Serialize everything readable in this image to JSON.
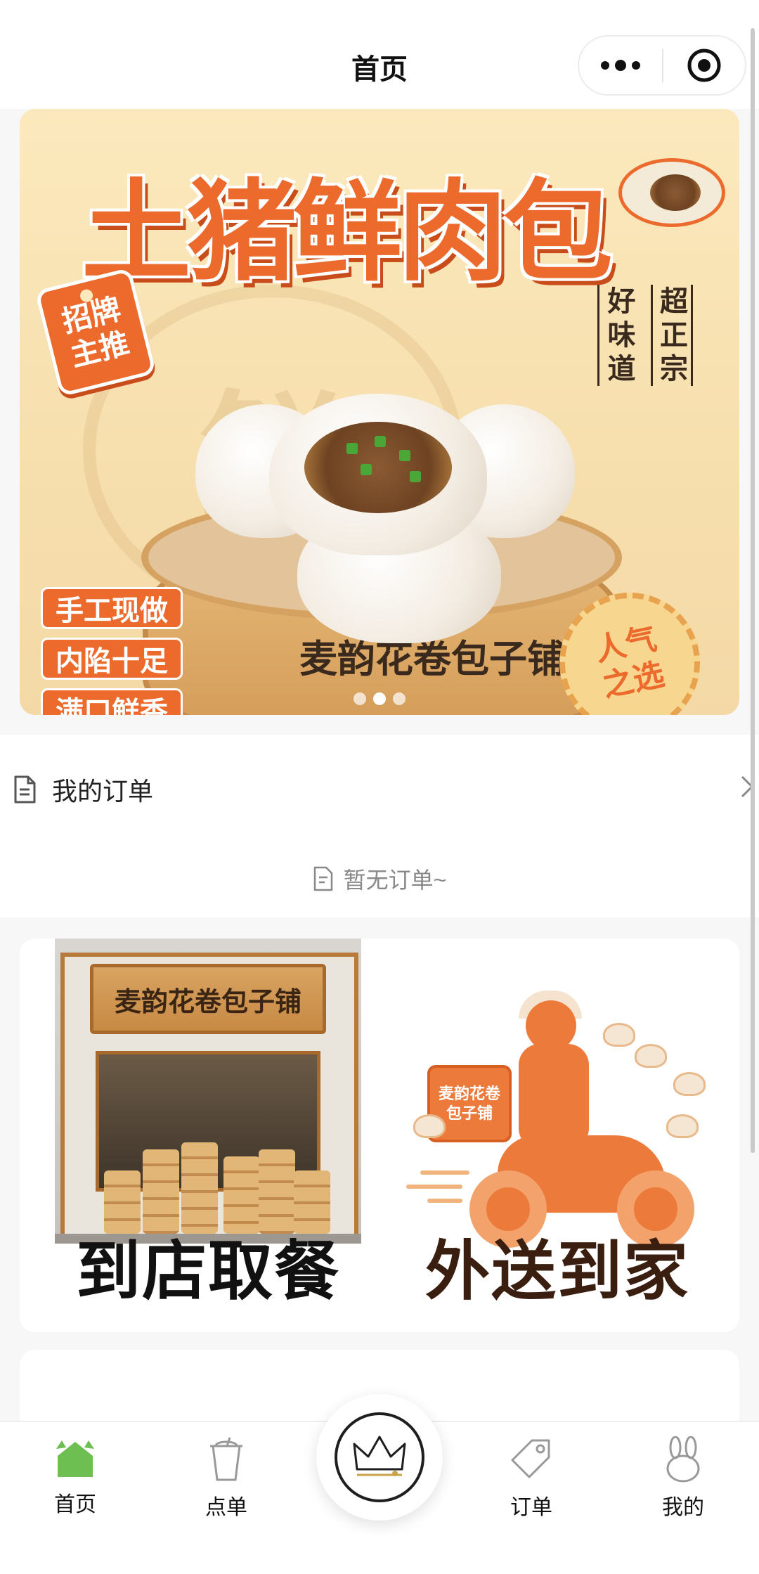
{
  "header": {
    "title": "首页"
  },
  "banner": {
    "headline": "土猪鲜肉包",
    "tag": [
      "招牌",
      "主推"
    ],
    "slogan_left": "好味道",
    "slogan_right": "超正宗",
    "watermark": "鲜",
    "chips": [
      "手工现做",
      "内陷十足",
      "满口鲜香"
    ],
    "brand": "麦韵花卷包子铺",
    "badge": [
      "人气",
      "之选"
    ],
    "slide_count": 3,
    "active_slide": 2
  },
  "orders": {
    "title": "我的订单",
    "empty_text": "暂无订单~"
  },
  "services": {
    "store": {
      "sign": "麦韵花卷包子铺",
      "caption": "到店取餐"
    },
    "delivery": {
      "box_label": "麦韵花卷 包子铺",
      "caption": "外送到家"
    }
  },
  "bottom_nav": {
    "items": [
      {
        "label": "首页",
        "icon": "home-icon",
        "active": true
      },
      {
        "label": "点单",
        "icon": "cup-icon"
      },
      {
        "label": "",
        "icon": "crown-icon"
      },
      {
        "label": "订单",
        "icon": "tag-icon"
      },
      {
        "label": "我的",
        "icon": "rabbit-icon"
      }
    ]
  },
  "colors": {
    "accent": "#ec6a2c",
    "home_active": "#6dbf52",
    "banner_bg": "#fbe9bd"
  }
}
